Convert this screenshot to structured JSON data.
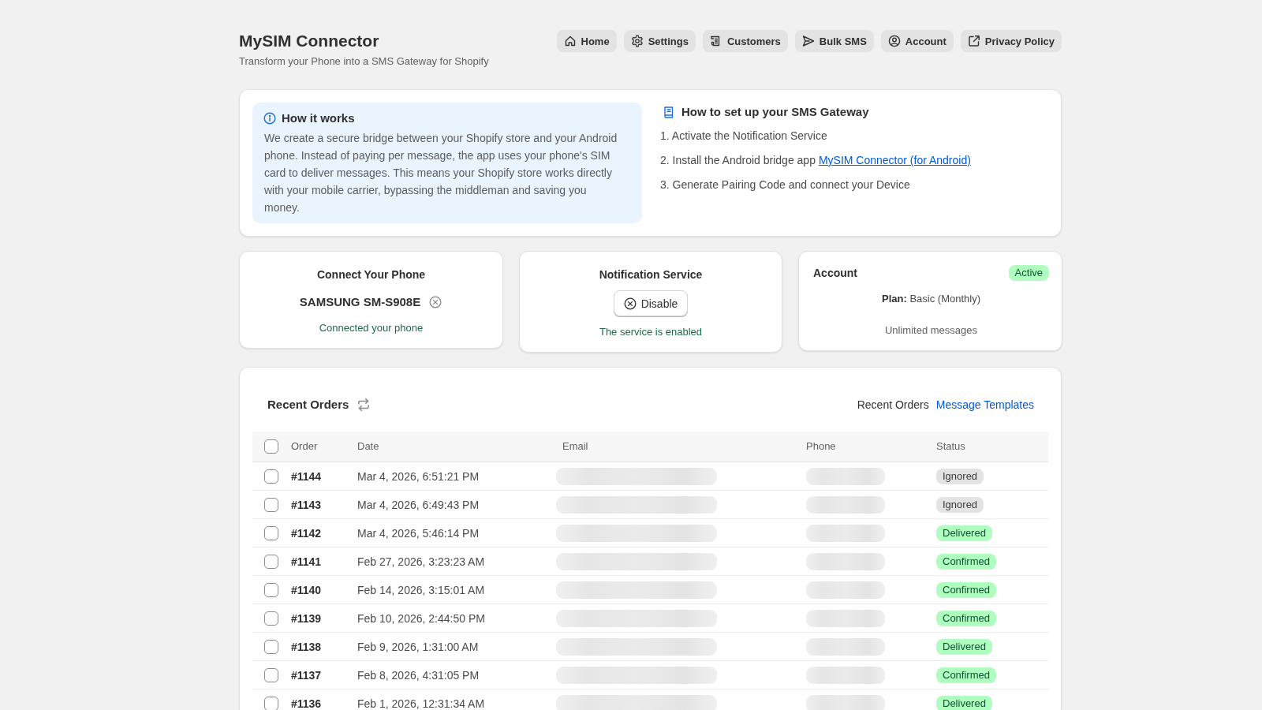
{
  "header": {
    "title": "MySIM Connector",
    "subtitle": "Transform your Phone into a SMS Gateway for Shopify"
  },
  "nav": [
    {
      "label": "Home"
    },
    {
      "label": "Settings"
    },
    {
      "label": "Customers"
    },
    {
      "label": "Bulk SMS"
    },
    {
      "label": "Account"
    },
    {
      "label": "Privacy Policy"
    }
  ],
  "how_it_works": {
    "title": "How it works",
    "text": "We create a secure bridge between your Shopify store and your Android phone. Instead of paying per message, the app uses your phone's SIM card to deliver messages. This means your Shopify store works directly with your mobile carrier, bypassing the middleman and saving you money."
  },
  "setup": {
    "title": "How to set up your SMS Gateway",
    "steps": [
      {
        "text": "1. Activate the Notification Service"
      },
      {
        "text": "2. Install the Android bridge app",
        "link": "MySIM Connector (for Android)"
      },
      {
        "text": "3. Generate Pairing Code and connect your Device"
      }
    ]
  },
  "connect_phone": {
    "title": "Connect Your Phone",
    "device": "SAMSUNG SM-S908E",
    "status": "Connected your phone"
  },
  "notification_service": {
    "title": "Notification Service",
    "button": "Disable",
    "status": "The service is enabled"
  },
  "account": {
    "title": "Account",
    "badge": "Active",
    "plan": "**Plan:** Basic (Monthly)",
    "messages": "Unlimited messages"
  },
  "orders": {
    "title": "Recent Orders",
    "views": [
      {
        "label": "Recent Orders",
        "selected": true
      },
      {
        "label": "Message Templates",
        "selected": false
      }
    ],
    "table": {
      "select_all": {
        "checked": false
      },
      "columns": [
        "Order",
        "Date",
        "Email",
        "Phone",
        "Status"
      ],
      "rows": [
        {
          "checked": false,
          "order": "#1144",
          "date": "Mar 4, 2026, 6:51:21 PM",
          "status": "Ignored",
          "color": "#e3e3e3"
        },
        {
          "checked": false,
          "order": "#1143",
          "date": "Mar 4, 2026, 6:49:43 PM",
          "status": "Ignored",
          "color": "#e3e3e3"
        },
        {
          "checked": false,
          "order": "#1142",
          "date": "Mar 4, 2026, 5:46:14 PM",
          "status": "Delivered",
          "color": "#affebf"
        },
        {
          "checked": false,
          "order": "#1141",
          "date": "Feb 27, 2026, 3:23:23 AM",
          "status": "Confirmed",
          "color": "#affebf"
        },
        {
          "checked": false,
          "order": "#1140",
          "date": "Feb 14, 2026, 3:15:01 AM",
          "status": "Confirmed",
          "color": "#affebf"
        },
        {
          "checked": false,
          "order": "#1139",
          "date": "Feb 10, 2026, 2:44:50 PM",
          "status": "Confirmed",
          "color": "#affebf"
        },
        {
          "checked": false,
          "order": "#1138",
          "date": "Feb 9, 2026, 1:31:00 AM",
          "status": "Delivered",
          "color": "#affebf"
        },
        {
          "checked": false,
          "order": "#1137",
          "date": "Feb 8, 2026, 4:31:05 PM",
          "status": "Confirmed",
          "color": "#affebf"
        },
        {
          "checked": false,
          "order": "#1136",
          "date": "Feb 1, 2026, 12:31:34 AM",
          "status": "Delivered",
          "color": "#affebf"
        }
      ]
    }
  }
}
